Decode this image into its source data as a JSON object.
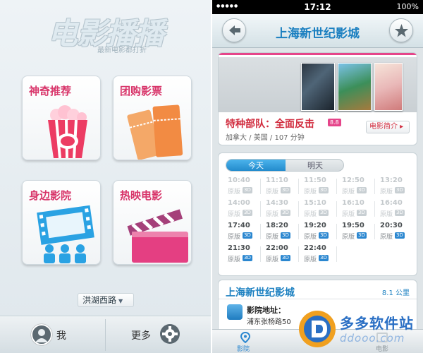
{
  "left_screen": {
    "logo": {
      "title": "电影播播",
      "tagline": "最新电影都打折"
    },
    "tiles": [
      {
        "label": "神奇推荐",
        "icon": "popcorn-icon"
      },
      {
        "label": "团购影票",
        "icon": "tickets-icon"
      },
      {
        "label": "身边影院",
        "icon": "film-strip-audience-icon"
      },
      {
        "label": "热映电影",
        "icon": "clapperboard-icon"
      }
    ],
    "location": {
      "label": "洪湖西路",
      "icon": "caret-down-icon"
    },
    "bottom_bar": {
      "me_label": "我",
      "more_label": "更多"
    }
  },
  "right_screen": {
    "status_bar": {
      "time": "17:12",
      "battery": "100%",
      "signal": "●●●●●"
    },
    "nav": {
      "title": "上海新世纪影城"
    },
    "movie": {
      "title": "特种部队：全面反击",
      "rating": "8.8",
      "meta": "加拿大 / 美国 / 107 分钟",
      "intro_button": "电影简介 ▸"
    },
    "showtimes": {
      "tabs": [
        "今天",
        "明天"
      ],
      "rows": [
        [
          {
            "time": "10:40",
            "edition": "原版",
            "badge": "3D",
            "state": "past"
          },
          {
            "time": "11:10",
            "edition": "原版",
            "badge": "3D",
            "state": "past"
          },
          {
            "time": "11:50",
            "edition": "原版",
            "badge": "3D",
            "state": "past"
          },
          {
            "time": "12:50",
            "edition": "原版",
            "badge": "3D",
            "state": "past"
          },
          {
            "time": "13:20",
            "edition": "原版",
            "badge": "3D",
            "state": "past"
          }
        ],
        [
          {
            "time": "14:00",
            "edition": "原版",
            "badge": "3D",
            "state": "past"
          },
          {
            "time": "14:30",
            "edition": "原版",
            "badge": "3D",
            "state": "past"
          },
          {
            "time": "15:10",
            "edition": "原版",
            "badge": "3D",
            "state": "past"
          },
          {
            "time": "16:10",
            "edition": "原版",
            "badge": "3D",
            "state": "past"
          },
          {
            "time": "16:40",
            "edition": "原版",
            "badge": "3D",
            "state": "past"
          }
        ],
        [
          {
            "time": "17:40",
            "edition": "原版",
            "badge": "3D",
            "state": "live"
          },
          {
            "time": "18:20",
            "edition": "原版",
            "badge": "3D",
            "state": "live"
          },
          {
            "time": "19:20",
            "edition": "原版",
            "badge": "3D",
            "state": "live"
          },
          {
            "time": "19:50",
            "edition": "原版",
            "badge": "3D",
            "state": "live"
          },
          {
            "time": "20:30",
            "edition": "原版",
            "badge": "3D",
            "state": "live"
          }
        ],
        [
          {
            "time": "21:30",
            "edition": "原版",
            "badge": "3D",
            "state": "live"
          },
          {
            "time": "22:00",
            "edition": "原版",
            "badge": "3D",
            "state": "live"
          },
          {
            "time": "22:40",
            "edition": "原版",
            "badge": "3D",
            "state": "live"
          }
        ]
      ]
    },
    "cinema": {
      "name": "上海新世纪影城",
      "distance": "8.1 公里",
      "address_label": "影院地址：",
      "address_value": "浦东张杨路50"
    },
    "tabbar": {
      "cinema_label": "影院",
      "movie_label": "电影"
    }
  },
  "watermark": {
    "line1": "多多软件站",
    "line2": "ddooo.com"
  },
  "colors": {
    "accent_pink": "#d8356a",
    "accent_blue": "#1a7fc0",
    "badge_blue": "#2b87d0"
  }
}
